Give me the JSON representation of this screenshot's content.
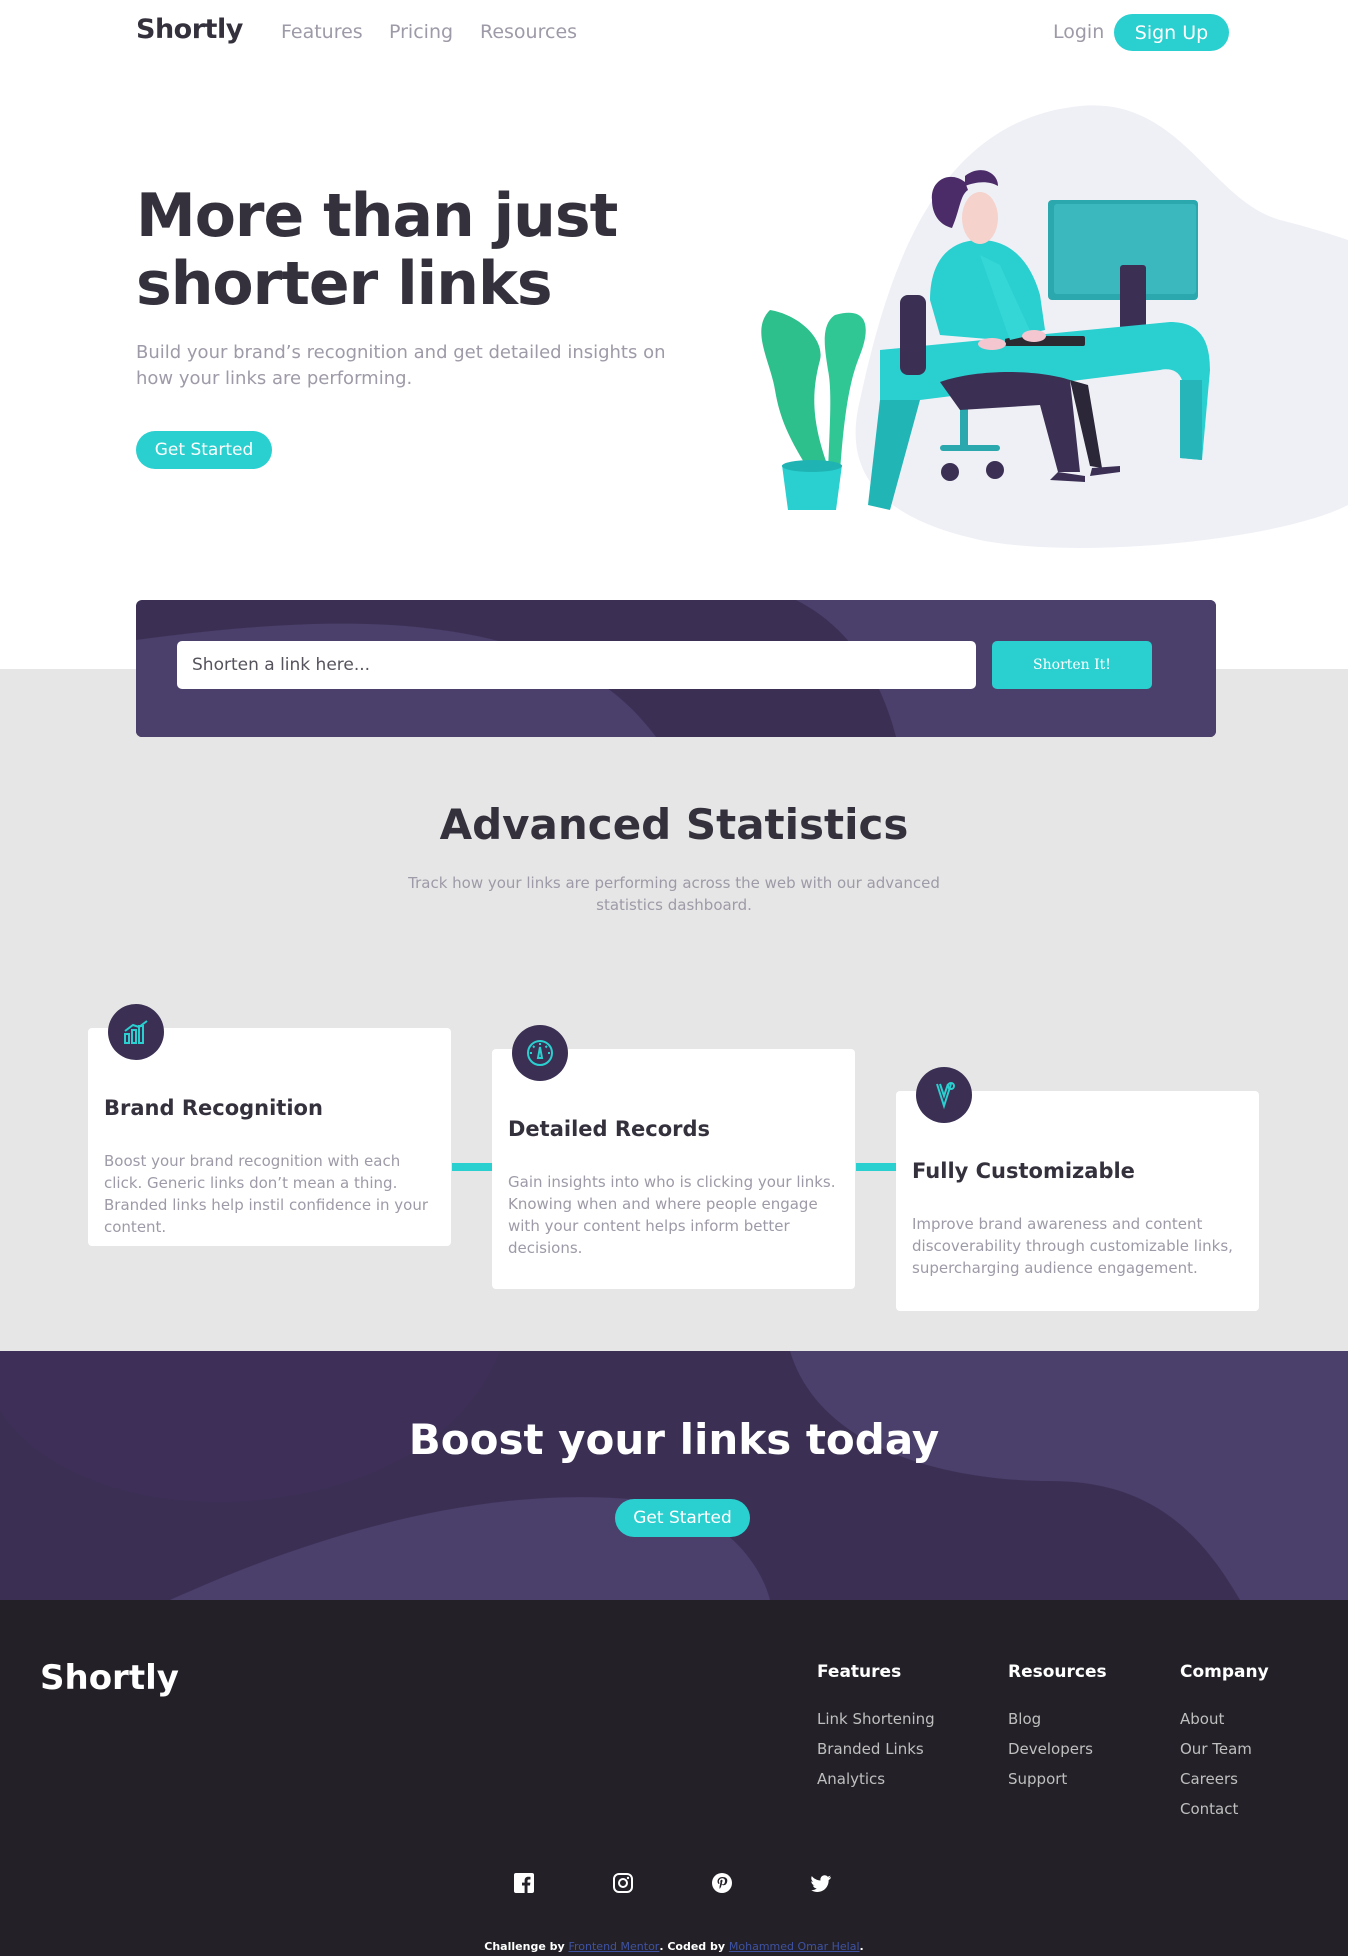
{
  "header": {
    "logo": "Shortly",
    "nav": [
      "Features",
      "Pricing",
      "Resources"
    ],
    "login": "Login",
    "signup": "Sign Up"
  },
  "hero": {
    "title": "More than just shorter links",
    "subtitle": "Build your brand’s recognition and get detailed insights on how your links are performing.",
    "cta": "Get Started",
    "illustration": "person-working-at-desk-illustration"
  },
  "shorten": {
    "placeholder": "Shorten a link here...",
    "button": "Shorten It!"
  },
  "stats": {
    "title": "Advanced Statistics",
    "subtitle": "Track how your links are performing across the web with our advanced statistics dashboard.",
    "cards": [
      {
        "icon": "bar-chart-icon",
        "title": "Brand Recognition",
        "text": "Boost your brand recognition with each click. Generic links don’t mean a thing. Branded links help instil confidence in your content."
      },
      {
        "icon": "gauge-icon",
        "title": "Detailed Records",
        "text": "Gain insights into who is clicking your links. Knowing when and where people engage with your content helps inform better decisions."
      },
      {
        "icon": "tools-icon",
        "title": "Fully Customizable",
        "text": "Improve brand awareness and content discoverability through customizable links, supercharging audience engagement."
      }
    ]
  },
  "boost": {
    "title": "Boost your links today",
    "cta": "Get Started"
  },
  "footer": {
    "logo": "Shortly",
    "columns": [
      {
        "title": "Features",
        "links": [
          "Link Shortening",
          "Branded Links",
          "Analytics"
        ]
      },
      {
        "title": "Resources",
        "links": [
          "Blog",
          "Developers",
          "Support"
        ]
      },
      {
        "title": "Company",
        "links": [
          "About",
          "Our Team",
          "Careers",
          "Contact"
        ]
      }
    ],
    "socials": [
      "facebook-icon",
      "instagram-icon",
      "pinterest-icon",
      "twitter-icon"
    ],
    "attribution": {
      "prefix": "Challenge by ",
      "challenge_link": "Frontend Mentor",
      "middle": ". Coded by ",
      "author_link": "Mohammed Omar Helal",
      "suffix": "."
    }
  },
  "colors": {
    "accent": "#2acfcf",
    "dark_violet": "#3b3054",
    "very_dark": "#232127",
    "grey_text": "#9e9aa7"
  }
}
